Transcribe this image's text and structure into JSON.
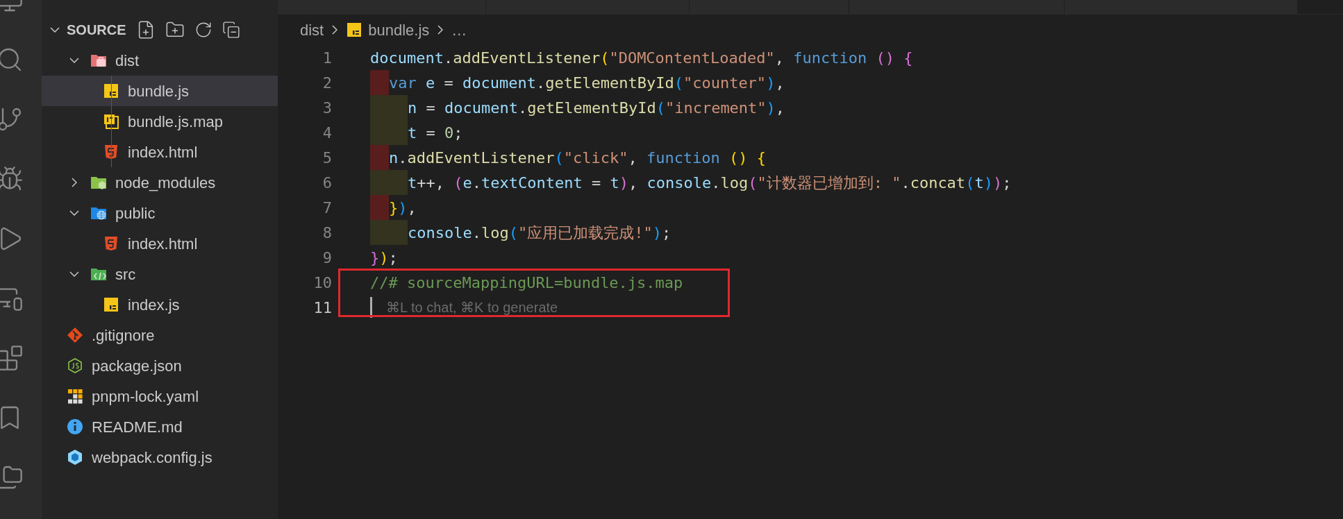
{
  "explorer": {
    "title": "SOURCE",
    "expanded": true,
    "items": [
      {
        "name": "dist",
        "kind": "dist",
        "expanded": true,
        "selected": false,
        "children": [
          {
            "name": "bundle.js",
            "kind": "js",
            "selected": true
          },
          {
            "name": "bundle.js.map",
            "kind": "map",
            "selected": false
          },
          {
            "name": "index.html",
            "kind": "html",
            "selected": false
          }
        ]
      },
      {
        "name": "node_modules",
        "kind": "packages",
        "expanded": false,
        "selected": false
      },
      {
        "name": "public",
        "kind": "web",
        "expanded": true,
        "selected": false,
        "children": [
          {
            "name": "index.html",
            "kind": "html",
            "selected": false
          }
        ]
      },
      {
        "name": "src",
        "kind": "code",
        "expanded": true,
        "selected": false,
        "children": [
          {
            "name": "index.js",
            "kind": "js",
            "selected": false
          }
        ]
      },
      {
        "name": ".gitignore",
        "kind": "git",
        "selected": false
      },
      {
        "name": "package.json",
        "kind": "npm",
        "selected": false
      },
      {
        "name": "pnpm-lock.yaml",
        "kind": "pnpm",
        "selected": false
      },
      {
        "name": "README.md",
        "kind": "info",
        "selected": false
      },
      {
        "name": "webpack.config.js",
        "kind": "webpack",
        "selected": false
      }
    ]
  },
  "breadcrumb": [
    {
      "text": "dist",
      "kind": "folder"
    },
    {
      "text": "bundle.js",
      "kind": "js"
    },
    {
      "text": "…",
      "kind": "more"
    }
  ],
  "editor": {
    "lines": [
      {
        "number": "1",
        "kind": "flat",
        "tokens": [
          {
            "kind": "var",
            "text": "document"
          },
          {
            "kind": "punct",
            "text": "."
          },
          {
            "kind": "fn",
            "text": "addEventListener"
          },
          {
            "kind": "b1",
            "text": "("
          },
          {
            "kind": "str",
            "text": "\"DOMContentLoaded\""
          },
          {
            "kind": "punct",
            "text": ", "
          },
          {
            "kind": "kw",
            "text": "function"
          },
          {
            "kind": "b2",
            "text": " ()"
          },
          {
            "kind": "b2",
            "text": " {"
          }
        ]
      },
      {
        "number": "2",
        "kind": "shallow",
        "color": "#5a1d1d",
        "tokens": [
          {
            "kind": "kw",
            "text": "var"
          },
          {
            "kind": "var",
            "text": " e"
          },
          {
            "kind": "punct",
            "text": " = "
          },
          {
            "kind": "var",
            "text": "document"
          },
          {
            "kind": "punct",
            "text": "."
          },
          {
            "kind": "fn",
            "text": "getElementById"
          },
          {
            "kind": "b3",
            "text": "("
          },
          {
            "kind": "str",
            "text": "\"counter\""
          },
          {
            "kind": "b3",
            "text": ")"
          },
          {
            "kind": "punct",
            "text": ","
          }
        ]
      },
      {
        "number": "3",
        "kind": "deep",
        "color": "#33331f",
        "tokens": [
          {
            "kind": "var",
            "text": "n"
          },
          {
            "kind": "punct",
            "text": " = "
          },
          {
            "kind": "var",
            "text": "document"
          },
          {
            "kind": "punct",
            "text": "."
          },
          {
            "kind": "fn",
            "text": "getElementById"
          },
          {
            "kind": "b3",
            "text": "("
          },
          {
            "kind": "str",
            "text": "\"increment\""
          },
          {
            "kind": "b3",
            "text": ")"
          },
          {
            "kind": "punct",
            "text": ","
          }
        ]
      },
      {
        "number": "4",
        "kind": "deep",
        "color": "#33331f",
        "tokens": [
          {
            "kind": "var",
            "text": "t"
          },
          {
            "kind": "punct",
            "text": " = "
          },
          {
            "kind": "num",
            "text": "0"
          },
          {
            "kind": "punct",
            "text": ";"
          }
        ]
      },
      {
        "number": "5",
        "kind": "shallow",
        "color": "#5a1d1d",
        "tokens": [
          {
            "kind": "var",
            "text": "n"
          },
          {
            "kind": "punct",
            "text": "."
          },
          {
            "kind": "fn",
            "text": "addEventListener"
          },
          {
            "kind": "b3",
            "text": "("
          },
          {
            "kind": "str",
            "text": "\"click\""
          },
          {
            "kind": "punct",
            "text": ", "
          },
          {
            "kind": "kw",
            "text": "function"
          },
          {
            "kind": "b1",
            "text": " ()"
          },
          {
            "kind": "b1",
            "text": " {"
          }
        ]
      },
      {
        "number": "6",
        "kind": "deep",
        "color": "#33331f",
        "tokens": [
          {
            "kind": "var",
            "text": "t"
          },
          {
            "kind": "punct",
            "text": "++, "
          },
          {
            "kind": "b2",
            "text": "("
          },
          {
            "kind": "var",
            "text": "e"
          },
          {
            "kind": "punct",
            "text": "."
          },
          {
            "kind": "var",
            "text": "textContent"
          },
          {
            "kind": "punct",
            "text": " = "
          },
          {
            "kind": "var",
            "text": "t"
          },
          {
            "kind": "b2",
            "text": ")"
          },
          {
            "kind": "punct",
            "text": ", "
          },
          {
            "kind": "var",
            "text": "console"
          },
          {
            "kind": "punct",
            "text": "."
          },
          {
            "kind": "fn",
            "text": "log"
          },
          {
            "kind": "b2",
            "text": "("
          },
          {
            "kind": "str",
            "text": "\"计数器已增加到: \""
          },
          {
            "kind": "punct",
            "text": "."
          },
          {
            "kind": "fn",
            "text": "concat"
          },
          {
            "kind": "b3",
            "text": "("
          },
          {
            "kind": "var",
            "text": "t"
          },
          {
            "kind": "b3",
            "text": ")"
          },
          {
            "kind": "b2",
            "text": ")"
          },
          {
            "kind": "punct",
            "text": ";"
          }
        ]
      },
      {
        "number": "7",
        "kind": "shallow",
        "color": "#5a1d1d",
        "tokens": [
          {
            "kind": "b1",
            "text": "}"
          },
          {
            "kind": "b3",
            "text": ")"
          },
          {
            "kind": "punct",
            "text": ","
          }
        ]
      },
      {
        "number": "8",
        "kind": "deep",
        "color": "#33331f",
        "tokens": [
          {
            "kind": "var",
            "text": "console"
          },
          {
            "kind": "punct",
            "text": "."
          },
          {
            "kind": "fn",
            "text": "log"
          },
          {
            "kind": "b3",
            "text": "("
          },
          {
            "kind": "str",
            "text": "\"应用已加载完成!\""
          },
          {
            "kind": "b3",
            "text": ")"
          },
          {
            "kind": "punct",
            "text": ";"
          }
        ]
      },
      {
        "number": "9",
        "kind": "flat",
        "tokens": [
          {
            "kind": "b2",
            "text": "}"
          },
          {
            "kind": "b1",
            "text": ")"
          },
          {
            "kind": "punct",
            "text": ";"
          }
        ]
      },
      {
        "number": "10",
        "kind": "flat",
        "tokens": [
          {
            "kind": "comment",
            "text": "//# sourceMappingURL=bundle.js.map"
          }
        ]
      },
      {
        "number": "11",
        "kind": "flat",
        "active": true,
        "hint": "⌘L to chat, ⌘K to generate"
      }
    ]
  }
}
